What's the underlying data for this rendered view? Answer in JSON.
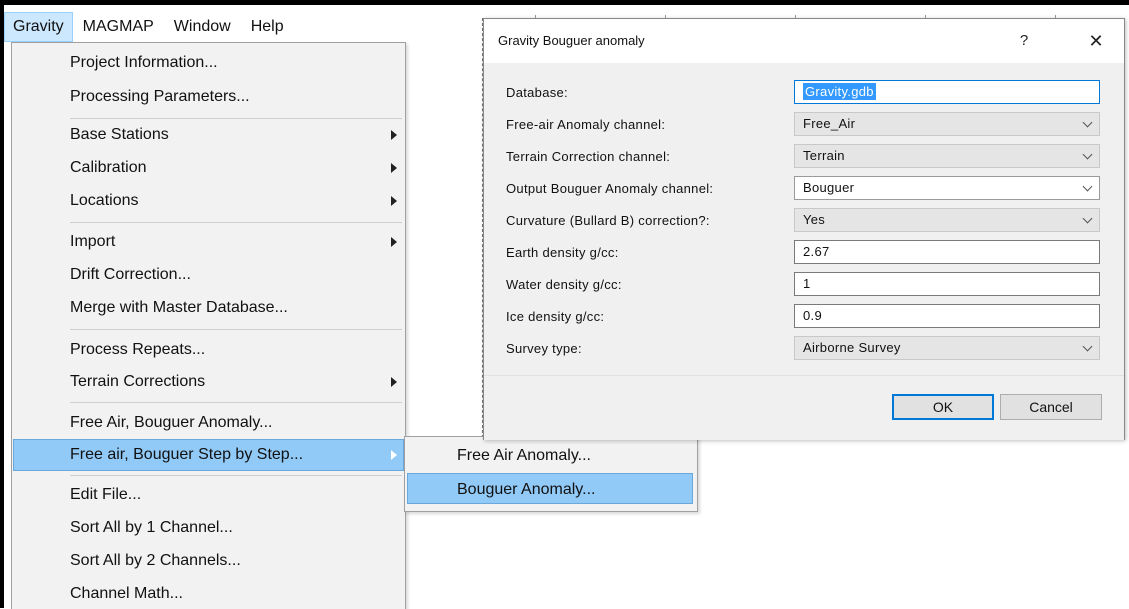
{
  "menubar": {
    "items": [
      "Gravity",
      "MAGMAP",
      "Window",
      "Help"
    ]
  },
  "menu": {
    "project_information": "Project Information...",
    "processing_parameters": "Processing Parameters...",
    "base_stations": "Base Stations",
    "calibration": "Calibration",
    "locations": "Locations",
    "import": "Import",
    "drift_correction": "Drift Correction...",
    "merge_master": "Merge with Master Database...",
    "process_repeats": "Process Repeats...",
    "terrain_corrections": "Terrain Corrections",
    "free_air_bouguer": "Free Air, Bouguer Anomaly...",
    "free_air_step": "Free air, Bouguer Step by Step...",
    "edit_file": "Edit File...",
    "sort_1": "Sort All by 1 Channel...",
    "sort_2": "Sort All by 2 Channels...",
    "channel_math": "Channel Math..."
  },
  "submenu": {
    "free_air_anomaly": "Free Air Anomaly...",
    "bouguer_anomaly": "Bouguer Anomaly..."
  },
  "dialog": {
    "title": "Gravity Bouguer anomaly",
    "help": "?",
    "close": "✕",
    "fields": {
      "database": {
        "label": "Database:",
        "value": "Gravity.gdb"
      },
      "free_air": {
        "label": "Free-air Anomaly channel:",
        "value": "Free_Air"
      },
      "terrain": {
        "label": "Terrain Correction channel:",
        "value": "Terrain"
      },
      "output": {
        "label": "Output Bouguer Anomaly channel:",
        "value": "Bouguer"
      },
      "curvature": {
        "label": "Curvature (Bullard B) correction?:",
        "value": "Yes"
      },
      "earth_density": {
        "label": "Earth density g/cc:",
        "value": "2.67"
      },
      "water_density": {
        "label": "Water density g/cc:",
        "value": "1"
      },
      "ice_density": {
        "label": "Ice density g/cc:",
        "value": "0.9"
      },
      "survey_type": {
        "label": "Survey type:",
        "value": "Airborne Survey"
      }
    },
    "ok": "OK",
    "cancel": "Cancel"
  }
}
